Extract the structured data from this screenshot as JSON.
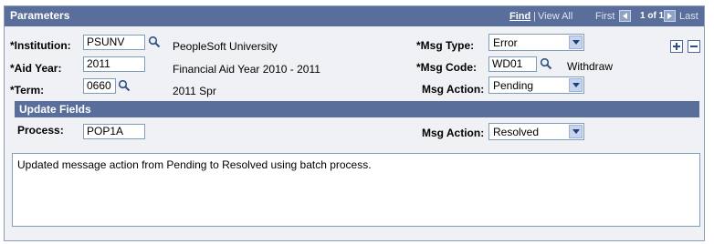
{
  "header": {
    "title": "Parameters",
    "find": "Find",
    "separator": "|",
    "view_all": "View All",
    "first": "First",
    "count": "1 of 1",
    "last": "Last"
  },
  "fields": {
    "institution": {
      "label": "*Institution:",
      "value": "PSUNV",
      "description": "PeopleSoft University"
    },
    "aid_year": {
      "label": "*Aid Year:",
      "value": "2011",
      "description": "Financial Aid Year 2010 - 2011"
    },
    "term": {
      "label": "*Term:",
      "value": "0660",
      "description": "2011 Spr"
    },
    "msg_type": {
      "label": "*Msg Type:",
      "selected": "Error"
    },
    "msg_code": {
      "label": "*Msg Code:",
      "value": "WD01",
      "description": "Withdraw"
    },
    "msg_action": {
      "label": "Msg Action:",
      "selected": "Pending"
    }
  },
  "update_fields": {
    "title": "Update Fields",
    "process": {
      "label": "Process:",
      "value": "POP1A"
    },
    "msg_action": {
      "label": "Msg Action:",
      "selected": "Resolved"
    }
  },
  "comment": "Updated message action from Pending to Resolved using batch process.",
  "colors": {
    "header_bg": "#5a6e9c",
    "panel_bg": "#f0f1f5",
    "border": "#7f9db9"
  }
}
